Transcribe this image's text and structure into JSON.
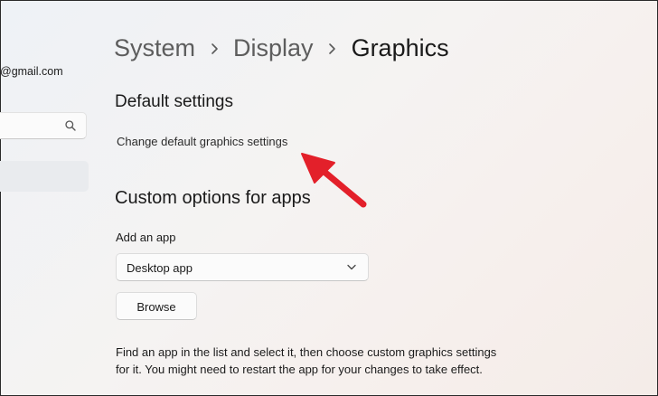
{
  "sidebar": {
    "account_email": "@gmail.com",
    "search_icon": "search-icon"
  },
  "breadcrumb": {
    "items": [
      "System",
      "Display",
      "Graphics"
    ],
    "separator_icon": "chevron-right-icon"
  },
  "default_settings": {
    "title": "Default settings",
    "link_text": "Change default graphics settings"
  },
  "custom_options": {
    "title": "Custom options for apps",
    "add_app_label": "Add an app",
    "dropdown_value": "Desktop app",
    "browse_label": "Browse",
    "help_text": "Find an app in the list and select it, then choose custom graphics settings for it. You might need to restart the app for your changes to take effect."
  },
  "annotation": {
    "arrow_color": "#e3202a",
    "arrow_icon": "red-arrow-annotation"
  }
}
